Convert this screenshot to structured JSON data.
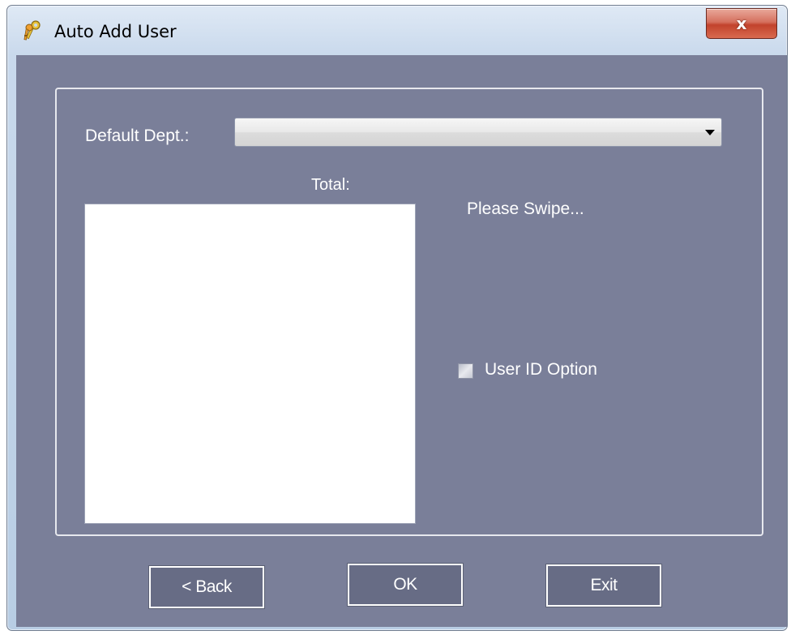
{
  "window": {
    "title": "Auto Add User",
    "icon": "keys-icon",
    "close_label": "x"
  },
  "form": {
    "dept_label": "Default Dept.:",
    "dept_value": "",
    "total_label": "Total:",
    "status_text": "Please Swipe...",
    "user_id_option_label": "User ID Option",
    "user_id_option_checked": false,
    "user_list": []
  },
  "buttons": {
    "back_label": "< Back",
    "ok_label": "OK",
    "exit_label": "Exit"
  },
  "colors": {
    "client_background": "#7a7f99",
    "button_background": "#676c85",
    "close_button": "#c2432c"
  }
}
